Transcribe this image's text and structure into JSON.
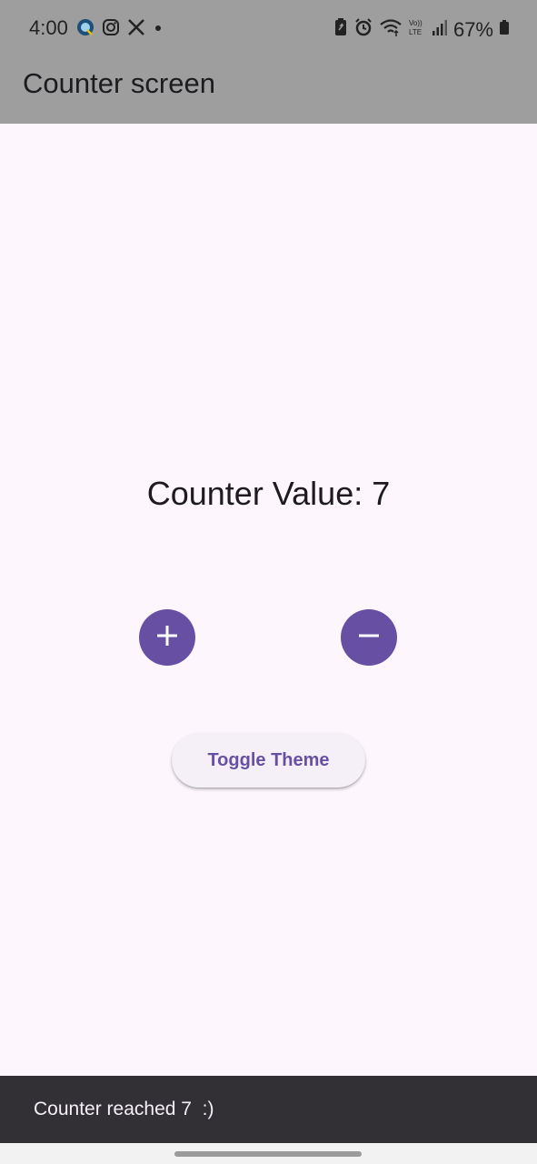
{
  "status_bar": {
    "time": "4:00",
    "battery_percent": "67%",
    "left_icons": [
      "app-notification-icon",
      "instagram-icon",
      "x-icon",
      "dot-icon"
    ],
    "right_icons": [
      "battery-saver-icon",
      "alarm-icon",
      "wifi-icon",
      "volte-icon",
      "signal-icon",
      "battery-icon"
    ]
  },
  "app_bar": {
    "title": "Counter screen"
  },
  "counter": {
    "label": "Counter Value: 7"
  },
  "buttons": {
    "increment_icon": "plus-icon",
    "decrement_icon": "minus-icon",
    "toggle_theme": "Toggle Theme"
  },
  "snackbar": {
    "message": "Counter reached 7  :)"
  },
  "colors": {
    "primary": "#6750a4",
    "app_bar": "#9e9e9e",
    "background": "#fdf7fd",
    "snackbar": "#322f35"
  }
}
